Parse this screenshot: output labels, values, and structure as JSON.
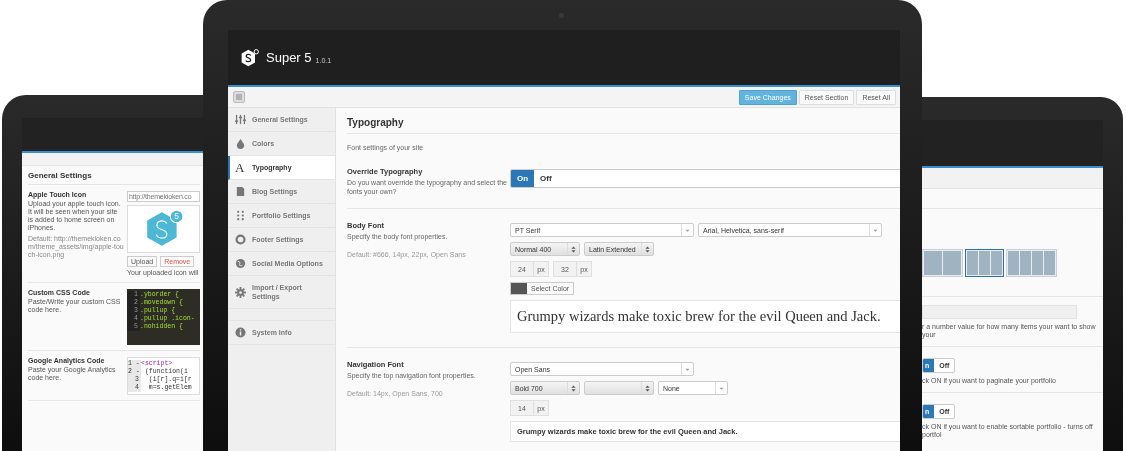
{
  "left_device": {
    "section_title": "General Settings",
    "apple_icon": {
      "title": "Apple Touch Icon",
      "description": "Upload your apple touch icon. It will be seen when your site is added to home screen on iPhones.",
      "default": "Default: http://themekioken.com/theme_assets/img/apple-touch-icon.png",
      "url": "http://themekioken.co",
      "badge": "5",
      "buttons": [
        {
          "label": "Upload",
          "kind": "default"
        },
        {
          "label": "Remove",
          "kind": "danger"
        }
      ],
      "note": "Your uploaded icon will"
    },
    "code_fields": [
      {
        "title": "Custom CSS Code",
        "description": "Paste/Write your custom CSS code here.",
        "lines": [
          {
            "num": "1",
            "code": ".yborder {"
          },
          {
            "num": "2",
            "code": ".movedown {"
          },
          {
            "num": "3",
            "code": ".pullup {"
          },
          {
            "num": "4",
            "code": ".pullup .icon-"
          },
          {
            "num": "5",
            "code": ".nohidden {"
          }
        ]
      },
      {
        "title": "Google Analytics Code",
        "description": "Paste your Google Analytics code here.",
        "lines": [
          {
            "num": "1 -",
            "code": "<script>"
          },
          {
            "num": "2 -",
            "code": " (function(i"
          },
          {
            "num": "3",
            "code": "  (i[r].q=i[r"
          },
          {
            "num": "4",
            "code": "  m=s.getElem"
          }
        ]
      }
    ]
  },
  "main_device": {
    "app_name": "Super 5",
    "version": "1.0.1",
    "toolbar_buttons": [
      {
        "label": "Save Changes",
        "kind": "primary"
      },
      {
        "label": "Reset Section",
        "kind": "default"
      },
      {
        "label": "Reset All",
        "kind": "default"
      }
    ],
    "sidebar": [
      {
        "label": "General Settings",
        "selected": false
      },
      {
        "label": "Colors",
        "selected": false
      },
      {
        "label": "Typography",
        "glyph": "A",
        "selected": true
      },
      {
        "label": "Blog Settings",
        "selected": false
      },
      {
        "label": "Portfolio Settings",
        "selected": false
      },
      {
        "label": "Footer Settings",
        "selected": false
      },
      {
        "label": "Social Media Options",
        "selected": false
      },
      {
        "label": "Import / Export Settings",
        "selected": false
      },
      {
        "label": "System Info",
        "selected": false
      }
    ],
    "title": "Typography",
    "subtitle": "Font settings of your site",
    "override": {
      "title": "Override Typography",
      "description": "Do you want override the typography and select the fonts your own?",
      "on_label": "On",
      "off_label": "Off",
      "on": true
    },
    "fonts": [
      {
        "title": "Body Font",
        "description": "Specify the body font properties.",
        "default": "Default: #666, 14px, 22px, Open Sans",
        "rows": [
          [
            {
              "value": "PT Serif",
              "kind": "combo"
            },
            {
              "value": "Arial, Helvetica, sans-serif",
              "kind": "combo"
            }
          ],
          [
            {
              "value": "Normal 400",
              "kind": "spinner"
            },
            {
              "value": "Latin Extended",
              "kind": "spinner"
            }
          ]
        ],
        "sizes": [
          {
            "value": "24",
            "unit": "px"
          },
          {
            "value": "32",
            "unit": "px"
          }
        ],
        "color": {
          "color": "#555555",
          "label": "Select Color"
        },
        "preview": {
          "text": "Grumpy wizards make toxic brew for the evil Queen and Jack.",
          "kind": "serif"
        }
      },
      {
        "title": "Navigation Font",
        "description": "Specify the top navigation font properties.",
        "default": "Default: 14px, Open Sans, 700",
        "rows": [
          [
            {
              "value": "Open Sans",
              "kind": "combo"
            }
          ],
          [
            {
              "value": "Bold 700",
              "kind": "spinner"
            },
            {
              "kind": "spinner"
            },
            {
              "value": "None",
              "kind": "combo"
            }
          ]
        ],
        "sizes": [
          {
            "value": "14",
            "unit": "px"
          }
        ],
        "preview": {
          "text": "Grumpy wizards make toxic brew for the evil Queen and Jack.",
          "kind": "sans-bold"
        }
      }
    ]
  },
  "right_device": {
    "layouts": [
      {
        "kind": "two",
        "selected": false
      },
      {
        "kind": "three",
        "selected": true
      },
      {
        "kind": "four",
        "selected": false
      }
    ],
    "items_description": "r a number value for how many items your want to show your",
    "toggles": [
      {
        "on_label": "n",
        "off_label": "Off",
        "on": true,
        "description": "ck ON if you want to paginate your portfolio"
      },
      {
        "on_label": "n",
        "off_label": "Off",
        "on": true,
        "description": "ck ON if you want to enable sortable portfolio - turns off portfol"
      }
    ]
  }
}
